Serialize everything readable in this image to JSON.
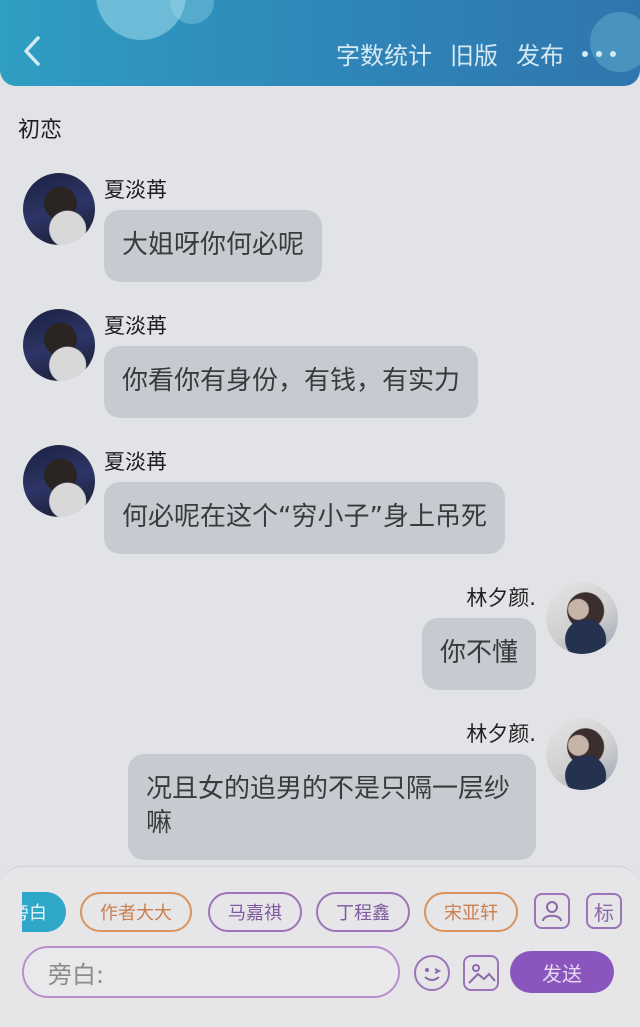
{
  "header": {
    "back_icon": "chevron-left-icon",
    "word_count": "字数统计",
    "old_version": "旧版",
    "publish": "发布",
    "more_icon": "more-dots-icon"
  },
  "chat": {
    "title": "初恋",
    "messages": [
      {
        "side": "left",
        "sender": "夏淡苒",
        "text": "大姐呀你何必呢"
      },
      {
        "side": "left",
        "sender": "夏淡苒",
        "text": "你看你有身份，有钱，有实力"
      },
      {
        "side": "left",
        "sender": "夏淡苒",
        "text": "何必呢在这个“穷小子”身上吊死"
      },
      {
        "side": "right",
        "sender": "林夕颜.",
        "text": "你不懂"
      },
      {
        "side": "right",
        "sender": "林夕颜.",
        "text": "况且女的追男的不是只隔一层纱嘛"
      }
    ]
  },
  "roles": {
    "chips": [
      "旁白",
      "作者大大",
      "马嘉祺",
      "丁程鑫",
      "宋亚轩"
    ],
    "visible_chip_texts": [
      "旁白",
      "作者大大",
      "马嘉祺",
      "丁程鑫",
      "宋亚轩"
    ],
    "active": "旁白",
    "mark_label": "标"
  },
  "composer": {
    "placeholder": "旁白:",
    "send_label": "发送",
    "emoji_icon": "emoji-icon",
    "image_icon": "image-icon",
    "person_icon": "person-card-icon"
  },
  "colors": {
    "header": "#2f8fbd",
    "bubble": "#c6cbd2",
    "accent_purple": "#8a55bd",
    "accent_orange": "#d9935c",
    "narration_chip": "#2fa7c8"
  }
}
